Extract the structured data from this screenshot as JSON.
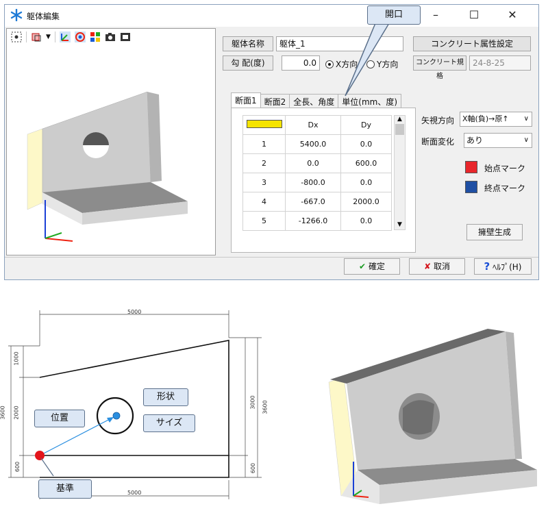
{
  "window": {
    "title": "躯体編集",
    "minimize": "–",
    "maximize": "☐",
    "close": "✕"
  },
  "form": {
    "name_label": "躯体名称",
    "name_value": "躯体_1",
    "slope_label": "勾 配(度)",
    "slope_value": "0.0",
    "dir_x": "X方向",
    "dir_y": "Y方向",
    "concrete_button": "コンクリート属性設定",
    "concrete_spec_label": "コンクリート規格",
    "concrete_spec_value": "24-8-25"
  },
  "tabs": [
    "断面1",
    "断面2",
    "全長、角度",
    "単位(mm、度)"
  ],
  "table": {
    "headers": [
      "",
      "Dx",
      "Dy"
    ],
    "rows": [
      [
        "1",
        "5400.0",
        "0.0"
      ],
      [
        "2",
        "0.0",
        "600.0"
      ],
      [
        "3",
        "-800.0",
        "0.0"
      ],
      [
        "4",
        "-667.0",
        "2000.0"
      ],
      [
        "5",
        "-1266.0",
        "0.0"
      ]
    ]
  },
  "view_dir": {
    "label": "矢視方向",
    "value": "X軸(負)→原↑"
  },
  "section_change": {
    "label": "断面変化",
    "value": "あり"
  },
  "start_mark": {
    "label": "始点マーク",
    "color": "#e8262b"
  },
  "end_mark": {
    "label": "終点マーク",
    "color": "#1f4fa3"
  },
  "wing_button": "擁壁生成",
  "footer": {
    "ok": "確定",
    "cancel": "取消",
    "help": "ﾍﾙﾌﾟ(H)"
  },
  "callouts": {
    "opening": "開口",
    "shape": "形状",
    "size": "サイズ",
    "position": "位置",
    "base": "基準"
  },
  "drawing_dims": {
    "top_width": "5000",
    "bottom_width": "5000",
    "left_total": "3600",
    "left_top": "1000",
    "left_mid": "2000",
    "left_bottom": "600",
    "right_total": "3600",
    "right_mid": "3000",
    "right_bottom": "600"
  },
  "colors": {
    "accent_yellow": "#f5e400",
    "callout_fill": "#dce7f5",
    "base_point": "#e3141b",
    "opening_point": "#2a8fe0"
  }
}
